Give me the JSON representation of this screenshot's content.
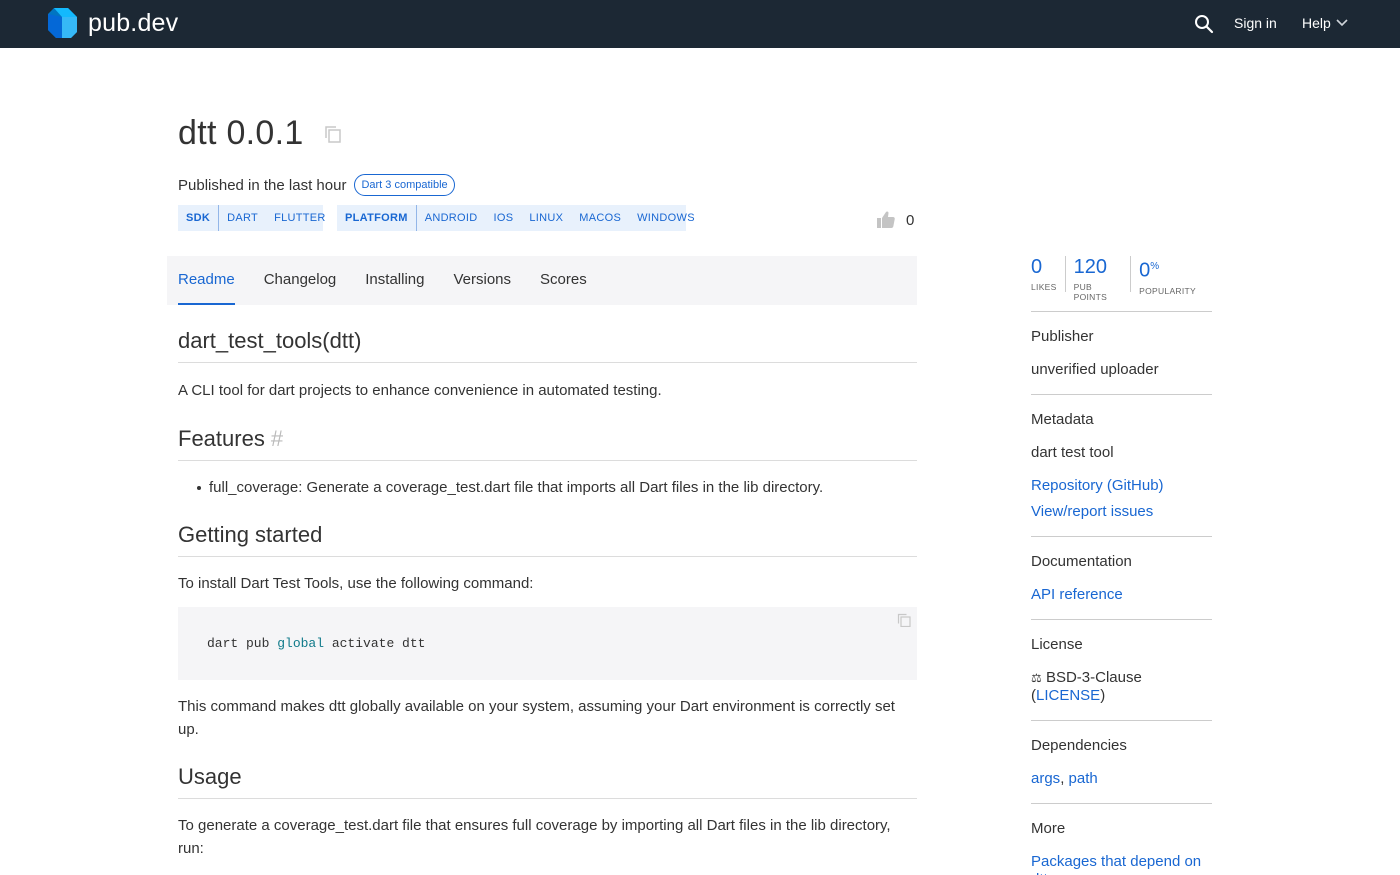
{
  "nav": {
    "logo_text": "pub.dev",
    "sign_in": "Sign in",
    "help": "Help"
  },
  "package": {
    "title": "dtt 0.0.1",
    "published": "Published in the last hour",
    "badge": "Dart 3 compatible",
    "sdk_label": "SDK",
    "sdk_tags": [
      "DART",
      "FLUTTER"
    ],
    "platform_label": "PLATFORM",
    "platform_tags": [
      "ANDROID",
      "IOS",
      "LINUX",
      "MACOS",
      "WINDOWS"
    ],
    "likes_count": "0"
  },
  "tabs": [
    "Readme",
    "Changelog",
    "Installing",
    "Versions",
    "Scores"
  ],
  "readme": {
    "h_main": "dart_test_tools(dtt)",
    "intro": "A CLI tool for dart projects to enhance convenience in automated testing.",
    "h_features": "Features",
    "features_anchor": "#",
    "feature_item": "full_coverage: Generate a coverage_test.dart file that imports all Dart files in the lib directory.",
    "h_getting_started": "Getting started",
    "install_text": "To install Dart Test Tools, use the following command:",
    "code_pre": "dart pub ",
    "code_kw": "global",
    "code_post": " activate dtt",
    "after_code": "This command makes dtt globally available on your system, assuming your Dart environment is correctly set up.",
    "h_usage": "Usage",
    "usage_text": "To generate a coverage_test.dart file that ensures full coverage by importing all Dart files in the lib directory, run:"
  },
  "sidebar": {
    "scores": [
      {
        "value": "0",
        "suffix": "",
        "label": "LIKES"
      },
      {
        "value": "120",
        "suffix": "",
        "label": "PUB POINTS"
      },
      {
        "value": "0",
        "suffix": "%",
        "label": "POPULARITY"
      }
    ],
    "publisher_title": "Publisher",
    "publisher": "unverified uploader",
    "metadata_title": "Metadata",
    "metadata_desc": "dart test tool",
    "repo_link": "Repository (GitHub)",
    "issues_link": "View/report issues",
    "documentation_title": "Documentation",
    "api_link": "API reference",
    "license_title": "License",
    "license_icon": "⚖",
    "license_name": "BSD-3-Clause",
    "license_link": "LICENSE",
    "dependencies_title": "Dependencies",
    "dep_args": "args",
    "dep_path": "path",
    "more_title": "More",
    "depend_link": "Packages that depend on dtt"
  },
  "colors": {
    "nav_bg": "#1c2834",
    "accent": "#1967d2",
    "tag_bg": "#e8f1fc"
  }
}
